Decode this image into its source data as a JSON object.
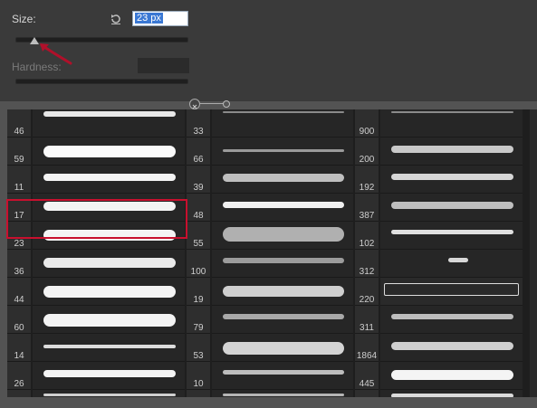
{
  "panel": {
    "size_label": "Size:",
    "size_value": "23 px",
    "hardness_label": "Hardness:"
  },
  "colors": {
    "selection_highlight": "#c8102e",
    "field_bg": "#2b2b2b",
    "panel_bg": "#3a3a3a"
  },
  "presets": {
    "columns": [
      {
        "numbers": [
          "46",
          "59",
          "11",
          "17",
          "23",
          "36",
          "44",
          "60",
          "14",
          "26",
          ""
        ]
      },
      {
        "numbers": [
          "33",
          "66",
          "39",
          "48",
          "55",
          "100",
          "19",
          "79",
          "53",
          "10",
          ""
        ]
      },
      {
        "numbers": [
          "900",
          "200",
          "192",
          "387",
          "102",
          "312",
          "220",
          "311",
          "1864",
          "445",
          ""
        ]
      }
    ],
    "selected": "23"
  }
}
